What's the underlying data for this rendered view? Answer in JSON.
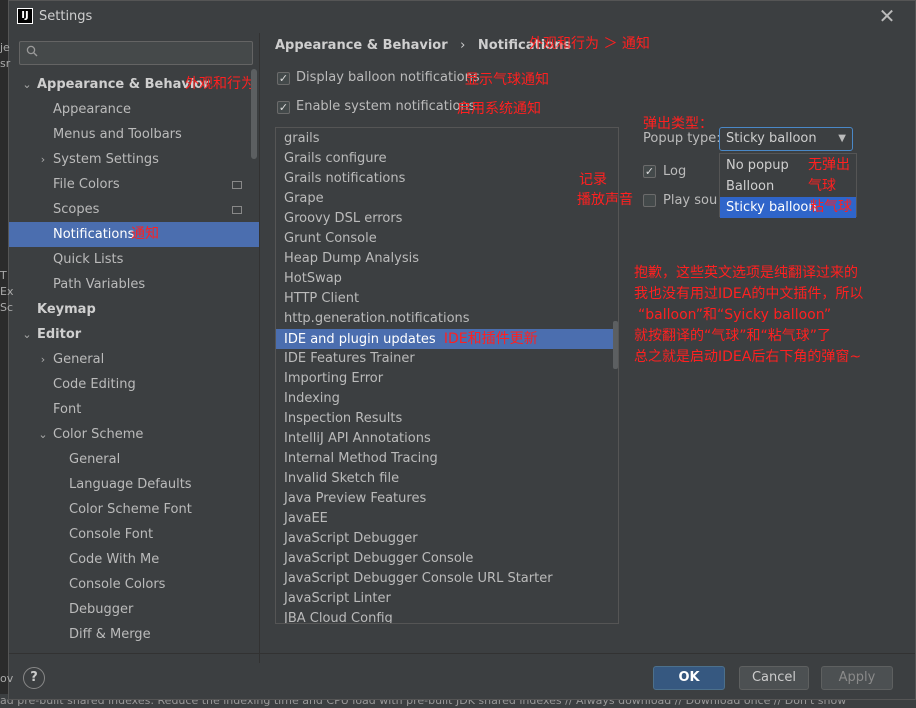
{
  "window": {
    "title": "Settings",
    "close_glyph": "✕"
  },
  "search": {
    "placeholder": "",
    "icon": "search-icon"
  },
  "sidebar": {
    "items": [
      {
        "label": "Appearance & Behavior",
        "annotation": "外观和行为"
      },
      {
        "label": "Appearance"
      },
      {
        "label": "Menus and Toolbars"
      },
      {
        "label": "System Settings"
      },
      {
        "label": "File Colors"
      },
      {
        "label": "Scopes"
      },
      {
        "label": "Notifications",
        "annotation": "通知"
      },
      {
        "label": "Quick Lists"
      },
      {
        "label": "Path Variables"
      },
      {
        "label": "Keymap"
      },
      {
        "label": "Editor"
      },
      {
        "label": "General"
      },
      {
        "label": "Code Editing"
      },
      {
        "label": "Font"
      },
      {
        "label": "Color Scheme"
      },
      {
        "label": "General"
      },
      {
        "label": "Language Defaults"
      },
      {
        "label": "Color Scheme Font"
      },
      {
        "label": "Console Font"
      },
      {
        "label": "Code With Me"
      },
      {
        "label": "Console Colors"
      },
      {
        "label": "Debugger"
      },
      {
        "label": "Diff & Merge"
      }
    ]
  },
  "breadcrumb": {
    "parent": "Appearance & Behavior",
    "separator": "›",
    "current": "Notifications",
    "annotation": "外观和行为 ＞ 通知"
  },
  "options": {
    "display_balloon": {
      "label": "Display balloon notifications",
      "checked": true,
      "annotation": "显示气球通知"
    },
    "system_notifications": {
      "label": "Enable system notifications",
      "checked": true,
      "annotation": "启用系统通知"
    }
  },
  "notification_groups": [
    "grails",
    "Grails configure",
    "Grails notifications",
    "Grape",
    "Groovy DSL errors",
    "Grunt Console",
    "Heap Dump Analysis",
    "HotSwap",
    "HTTP Client",
    "http.generation.notifications",
    "IDE and plugin updates",
    "IDE Features Trainer",
    "Importing Error",
    "Indexing",
    "Inspection Results",
    "IntelliJ API Annotations",
    "Internal Method Tracing",
    "Invalid Sketch file",
    "Java Preview Features",
    "JavaEE",
    "JavaScript Debugger",
    "JavaScript Debugger Console",
    "JavaScript Debugger Console URL Starter",
    "JavaScript Linter",
    "JBA Cloud Config"
  ],
  "selected_group_annotation": "IDE和插件更新",
  "popup_type": {
    "label": "Popup type:",
    "annotation": "弹出类型：",
    "value": "Sticky balloon",
    "options": [
      {
        "label": "No popup",
        "annotation": "无弹出"
      },
      {
        "label": "Balloon",
        "annotation": "气球"
      },
      {
        "label": "Sticky balloon",
        "annotation": "粘气球"
      }
    ]
  },
  "log": {
    "label": "Log",
    "checked": true,
    "annotation": "记录"
  },
  "play_sound": {
    "label": "Play sour",
    "checked": false,
    "annotation": "播放声音"
  },
  "note": {
    "lines": [
      "抱歉，这些英文选项是纯翻译过来的",
      "我也没有用过IDEA的中文插件，所以",
      "“balloon”和“Syicky balloon”",
      "就按翻译的“气球”和“粘气球”了",
      "总之就是启动IDEA后右下角的弹窗~"
    ]
  },
  "footer": {
    "help": "?",
    "ok": "OK",
    "cancel": "Cancel",
    "apply": "Apply"
  },
  "background": {
    "status_text": "ad pre-built shared indexes: Reduce the indexing time and CPU load with pre-built JDK shared indexes // Always download // Download once // Don't show",
    "left_letters": [
      "je",
      "sr",
      "",
      "",
      "",
      "",
      "",
      "",
      "",
      "",
      "",
      "",
      "T",
      "Ex",
      "Sc",
      "",
      "",
      "",
      "",
      "",
      "",
      "",
      "",
      "",
      "",
      "",
      "",
      "",
      "",
      "",
      "",
      "",
      "",
      "",
      "",
      "",
      "",
      "",
      "",
      "",
      "ov"
    ]
  },
  "colors": {
    "accent": "#4b6eaf",
    "annotation": "#ff2020",
    "background": "#3c3f41"
  }
}
